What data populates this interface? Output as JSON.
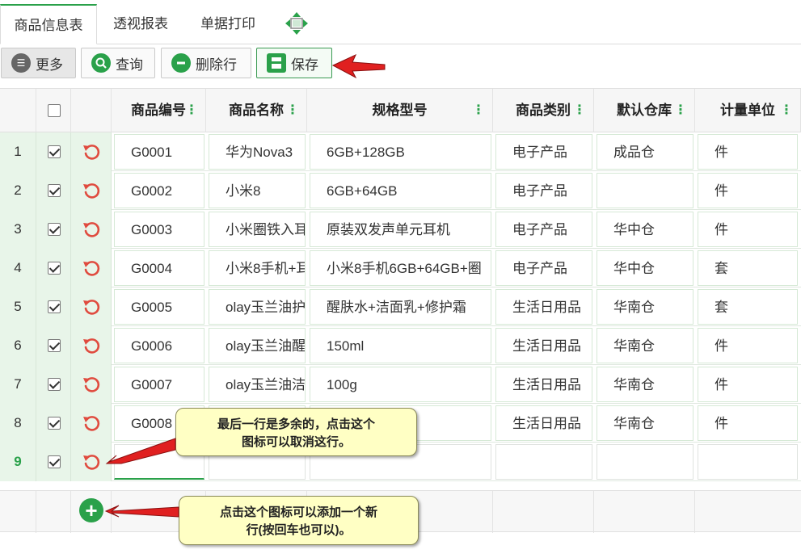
{
  "tabs": {
    "items": [
      "商品信息表",
      "透视报表",
      "单据打印"
    ],
    "active_index": 0
  },
  "toolbar": {
    "more": "更多",
    "query": "查询",
    "delete_row": "删除行",
    "save": "保存"
  },
  "table": {
    "columns": [
      "商品编号",
      "商品名称",
      "规格型号",
      "商品类别",
      "默认仓库",
      "计量单位"
    ],
    "rows": [
      {
        "num": "1",
        "code": "G0001",
        "name": "华为Nova3",
        "spec": "6GB+128GB",
        "category": "电子产品",
        "warehouse": "成品仓",
        "unit": "件"
      },
      {
        "num": "2",
        "code": "G0002",
        "name": "小米8",
        "spec": "6GB+64GB",
        "category": "电子产品",
        "warehouse": "",
        "unit": "件"
      },
      {
        "num": "3",
        "code": "G0003",
        "name": "小米圈铁入耳",
        "spec": "原装双发声单元耳机",
        "category": "电子产品",
        "warehouse": "华中仓",
        "unit": "件"
      },
      {
        "num": "4",
        "code": "G0004",
        "name": "小米8手机+耳",
        "spec": "小米8手机6GB+64GB+圈",
        "category": "电子产品",
        "warehouse": "华中仓",
        "unit": "套"
      },
      {
        "num": "5",
        "code": "G0005",
        "name": "olay玉兰油护",
        "spec": "醒肤水+洁面乳+修护霜",
        "category": "生活日用品",
        "warehouse": "华南仓",
        "unit": "套"
      },
      {
        "num": "6",
        "code": "G0006",
        "name": "olay玉兰油醒",
        "spec": "150ml",
        "category": "生活日用品",
        "warehouse": "华南仓",
        "unit": "件"
      },
      {
        "num": "7",
        "code": "G0007",
        "name": "olay玉兰油洁",
        "spec": "100g",
        "category": "生活日用品",
        "warehouse": "华南仓",
        "unit": "件"
      },
      {
        "num": "8",
        "code": "G0008",
        "name": "",
        "spec": "",
        "category": "生活日用品",
        "warehouse": "华南仓",
        "unit": "件"
      },
      {
        "num": "9",
        "code": "",
        "name": "",
        "spec": "",
        "category": "",
        "warehouse": "",
        "unit": ""
      }
    ]
  },
  "callouts": {
    "remove_row_tip_line1": "最后一行是多余的，点击这个",
    "remove_row_tip_line2": "图标可以取消这行。",
    "add_row_tip_line1": "点击这个图标可以添加一个新",
    "add_row_tip_line2": "行(按回车也可以)。"
  },
  "icons": {
    "tab_extra": "move-arrows-icon",
    "more": "menu-icon",
    "query": "search-icon",
    "delete_row": "minus-circle-icon",
    "save": "floppy-disk-icon",
    "row_action": "undo-circle-icon",
    "add_row": "plus-circle-icon"
  },
  "colors": {
    "accent": "#2aa14a",
    "row_header_bg": "#e8f5e9",
    "callout_bg": "#ffffc4",
    "arrow": "#e02020",
    "undo_icon": "#e04b3f"
  }
}
